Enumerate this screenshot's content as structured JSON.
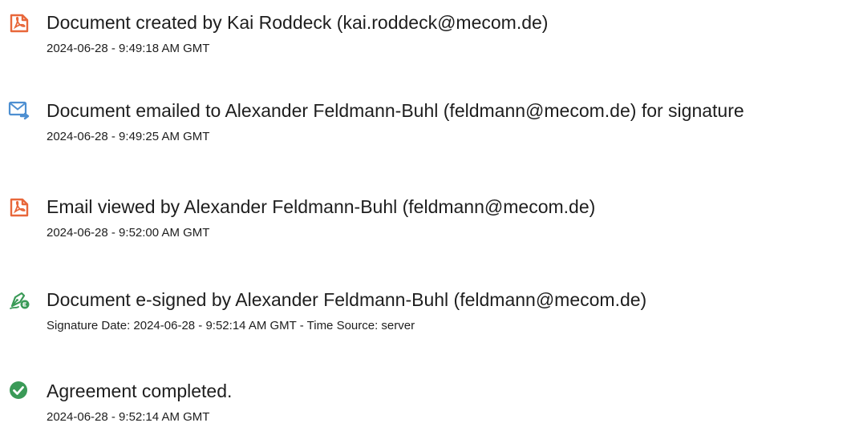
{
  "audit_events": [
    {
      "icon": "document-created-icon",
      "title": "Document created by Kai Roddeck (kai.roddeck@mecom.de)",
      "detail": "2024-06-28 - 9:49:18 AM GMT"
    },
    {
      "icon": "email-sent-icon",
      "title": "Document emailed to Alexander Feldmann-Buhl (feldmann@mecom.de) for signature",
      "detail": "2024-06-28 - 9:49:25 AM GMT"
    },
    {
      "icon": "document-viewed-icon",
      "title": "Email viewed by Alexander Feldmann-Buhl (feldmann@mecom.de)",
      "detail": "2024-06-28 - 9:52:00 AM GMT"
    },
    {
      "icon": "e-signature-pen-icon",
      "title": "Document e-signed by Alexander Feldmann-Buhl (feldmann@mecom.de)",
      "detail": "Signature Date: 2024-06-28 - 9:52:14 AM GMT - Time Source: server"
    },
    {
      "icon": "completed-checkmark-icon",
      "title": "Agreement completed.",
      "detail": "2024-06-28 - 9:52:14 AM GMT"
    }
  ],
  "colors": {
    "document_icon": "#e8673a",
    "email_icon": "#4d8fd1",
    "signature_icon": "#3a9a57",
    "completed_icon": "#3a9a57",
    "text": "#1e1e1e"
  }
}
